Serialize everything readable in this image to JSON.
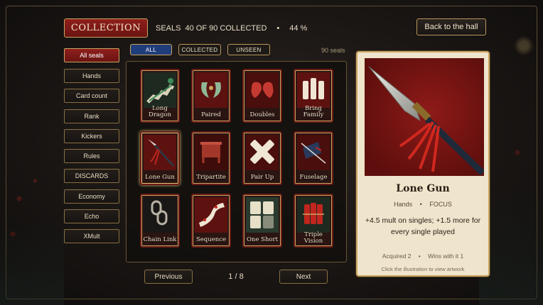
{
  "header": {
    "collection_label": "COLLECTION",
    "seals_label": "SEALS",
    "collected_text": "40 OF 90 COLLECTED",
    "separator": "•",
    "percent": "44 %",
    "back_label": "Back to the hall"
  },
  "filters": {
    "chips": [
      "ALL",
      "COLLECTED",
      "UNSEEN"
    ],
    "active": "ALL",
    "count_text": "90 seals"
  },
  "sidebar": {
    "items": [
      "All seals",
      "Hands",
      "Card count",
      "Rank",
      "Kickers",
      "Rules",
      "DISCARDS",
      "Economy",
      "Echo",
      "XMult"
    ],
    "active": "All seals"
  },
  "grid": {
    "cards": [
      {
        "name": "Long Dragon",
        "icon": "dragon-icon"
      },
      {
        "name": "Paired",
        "icon": "twin-jade-icon"
      },
      {
        "name": "Doubles",
        "icon": "twin-hearts-icon"
      },
      {
        "name": "Bring Family",
        "icon": "ivory-tiles-icon"
      },
      {
        "name": "Lone Gun",
        "icon": "spear-icon"
      },
      {
        "name": "Tripartite",
        "icon": "bronze-vessel-icon"
      },
      {
        "name": "Pair Up",
        "icon": "crossed-tiles-icon"
      },
      {
        "name": "Fuselage",
        "icon": "arrow-icon"
      },
      {
        "name": "Chain Link",
        "icon": "chain-icon"
      },
      {
        "name": "Sequence",
        "icon": "scroll-icon"
      },
      {
        "name": "One Short",
        "icon": "mahjong-tiles-icon"
      },
      {
        "name": "Triple Vision",
        "icon": "firecrackers-icon"
      }
    ],
    "selected": "Lone Gun"
  },
  "pagination": {
    "prev_label": "Previous",
    "next_label": "Next",
    "page_text": "1 / 8"
  },
  "detail": {
    "title": "Lone Gun",
    "category": "Hands",
    "tag": "FOCUS",
    "description": "+4.5 mult on singles; +1.5 more for every single played",
    "acquired": "Acquired 2",
    "wins": "Wins with it 1",
    "hint": "Click the illustration to view artwork"
  },
  "colors": {
    "accent_red": "#8e1f1c",
    "gold_border": "#c9a560",
    "active_chip_blue": "#1f3d7a",
    "panel_parchment": "#efe4cc"
  }
}
